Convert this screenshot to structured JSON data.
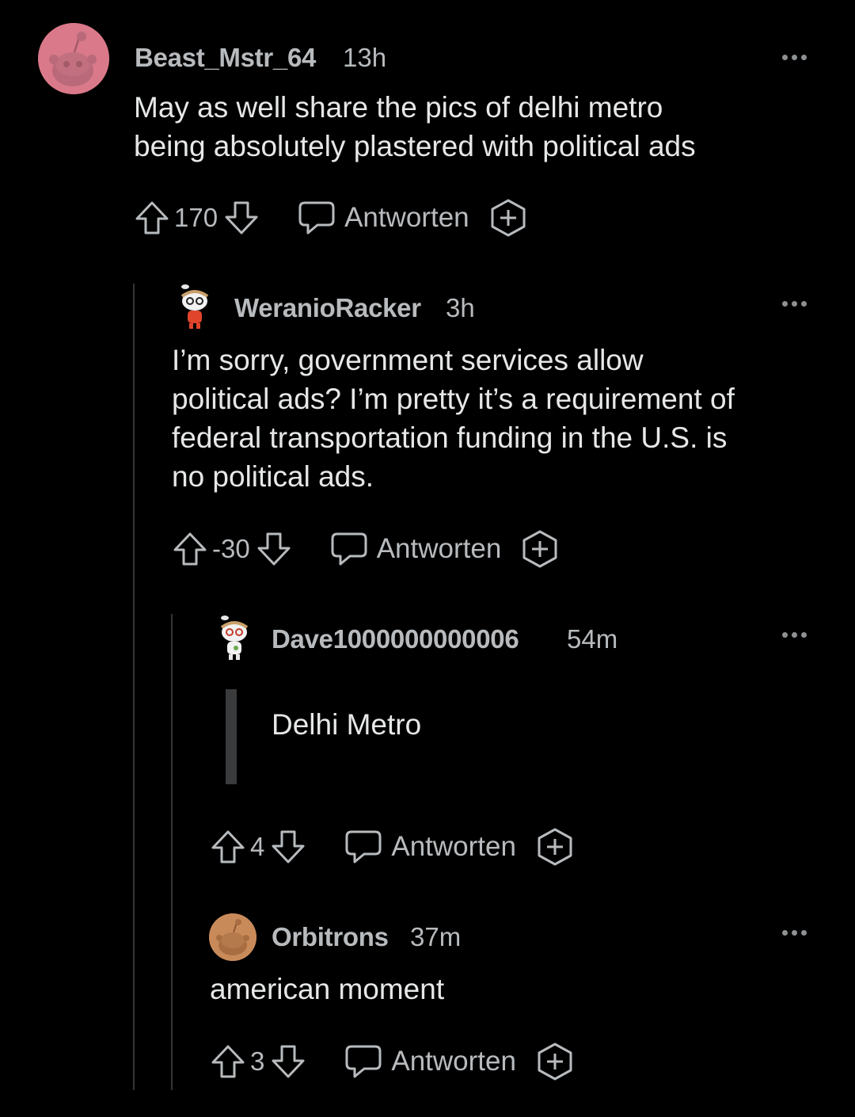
{
  "comments": [
    {
      "username": "Beast_Mstr_64",
      "time": "13h",
      "body_lines": [
        "May as well share the pics of delhi metro",
        "being absolutely plastered with political ads"
      ],
      "score": "170",
      "reply_label": "Antworten",
      "avatar": "snoo-default-avatar-pink"
    },
    {
      "username": "WeranioRacker",
      "time": "3h",
      "body_lines": [
        "I’m sorry, government services allow",
        "political ads? I’m pretty it’s a requirement of",
        "federal transportation funding in the U.S. is",
        "no political ads."
      ],
      "score": "-30",
      "reply_label": "Antworten",
      "avatar": "snoo-custom-avatar-red-shirt"
    },
    {
      "username": "Dave1000000000006",
      "time": "54m",
      "quote": "Delhi Metro",
      "score": "4",
      "reply_label": "Antworten",
      "avatar": "snoo-custom-avatar-white-shirt"
    },
    {
      "username": "Orbitrons",
      "time": "37m",
      "body_lines": [
        "american moment"
      ],
      "score": "3",
      "reply_label": "Antworten",
      "avatar": "snoo-default-avatar-orange"
    }
  ],
  "colors": {
    "background": "#000000",
    "text": "#e6e7e8",
    "meta": "#b8bbbe",
    "thread_line": "#343536",
    "avatar_pink": "#d9798a",
    "avatar_orange": "#c98a5a"
  }
}
